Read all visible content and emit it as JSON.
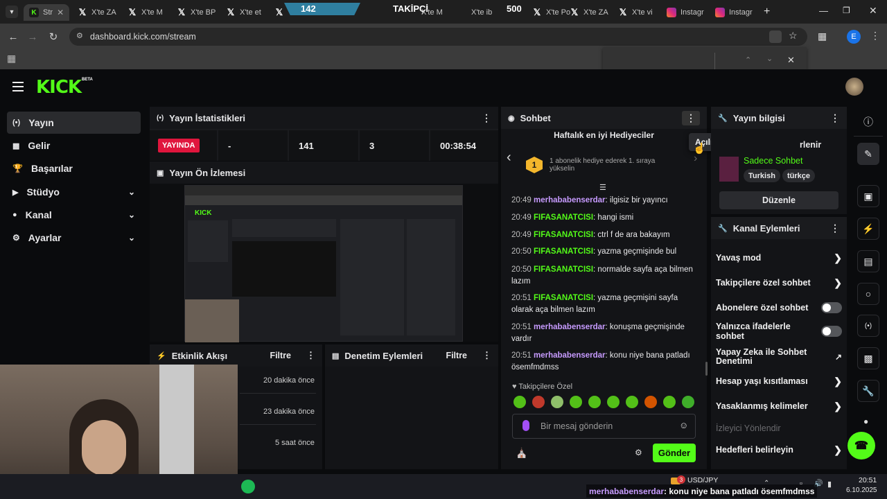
{
  "browser": {
    "tabs": [
      {
        "label": "Str",
        "icon": "kick-icon"
      },
      {
        "label": "X'te ZA",
        "icon": "x-icon"
      },
      {
        "label": "X'te M",
        "icon": "x-icon"
      },
      {
        "label": "X'te BP",
        "icon": "x-icon"
      },
      {
        "label": "X'te et",
        "icon": "x-icon"
      },
      {
        "label": "X'te M",
        "icon": "x-icon"
      },
      {
        "label": "X'te ib",
        "icon": "x-icon"
      },
      {
        "label": "X'te Po",
        "icon": "x-icon"
      },
      {
        "label": "X'te ZA",
        "icon": "x-icon"
      },
      {
        "label": "X'te vi",
        "icon": "x-icon"
      },
      {
        "label": "Instagr",
        "icon": "instagram-icon"
      },
      {
        "label": "Instagr",
        "icon": "instagram-icon"
      }
    ],
    "overlay_left": "142",
    "overlay_mid": "TAKİPÇİ",
    "overlay_right": "500",
    "url": "dashboard.kick.com/stream",
    "profile_initial": "E"
  },
  "kick": {
    "logo": "KICK",
    "beta": "BETA"
  },
  "sidebar": {
    "items": [
      {
        "label": "Yayın",
        "icon": "broadcast-icon",
        "active": true
      },
      {
        "label": "Gelir",
        "icon": "revenue-icon"
      },
      {
        "label": "Başarılar",
        "icon": "trophy-icon"
      },
      {
        "label": "Stüdyo",
        "icon": "studio-icon",
        "chevron": true
      },
      {
        "label": "Kanal",
        "icon": "channel-icon",
        "chevron": true
      },
      {
        "label": "Ayarlar",
        "icon": "settings-icon",
        "chevron": true
      }
    ]
  },
  "stats": {
    "title": "Yayın İstatistikleri",
    "live_badge": "YAYINDA",
    "values": [
      "-",
      "141",
      "3",
      "00:38:54"
    ]
  },
  "preview": {
    "title": "Yayın Ön İzlemesi"
  },
  "activity": {
    "title": "Etkinlik Akışı",
    "filter": "Filtre",
    "times": [
      "20 dakika önce",
      "23 dakika önce",
      "5 saat önce"
    ]
  },
  "moderation": {
    "title": "Denetim Eylemleri",
    "filter": "Filtre"
  },
  "chat": {
    "title": "Sohbet",
    "tooltip": "Açılır Pencerede Sohbet",
    "gifters_title": "Haftalık en iyi Hediyeciler",
    "gifters_text": "1 abonelik hediye ederek 1. sıraya yükselin",
    "rank": "1",
    "messages": [
      {
        "time": "20:49",
        "user": "merhababenserdar",
        "text": "ilgisiz bir yayıncı",
        "color": "u1"
      },
      {
        "time": "20:49",
        "user": "FIFASANATCISI",
        "text": "hangi ismi",
        "color": "u2"
      },
      {
        "time": "20:49",
        "user": "FIFASANATCISI",
        "text": "ctrl f de ara bakayım",
        "color": "u2"
      },
      {
        "time": "20:50",
        "user": "FIFASANATCISI",
        "text": "yazma geçmişinde bul",
        "color": "u2"
      },
      {
        "time": "20:50",
        "user": "FIFASANATCISI",
        "text": "normalde sayfa aça bilmen lazım",
        "color": "u2"
      },
      {
        "time": "20:51",
        "user": "FIFASANATCISI",
        "text": "yazma geçmişini sayfa olarak aça bilmen lazım",
        "color": "u2"
      },
      {
        "time": "20:51",
        "user": "merhababenserdar",
        "text": "konuşma geçmişinde vardır",
        "color": "u1"
      },
      {
        "time": "20:51",
        "user": "merhababenserdar",
        "text": "konu niye bana patladı ösemfmdmss",
        "color": "u1"
      }
    ],
    "followers_only": "Takipçilere Özel",
    "input_placeholder": "Bir mesaj gönderin",
    "send": "Gönder"
  },
  "stream_info": {
    "title": "Yayın bilgisi",
    "partial_text": "rlenir",
    "category": "Sadece Sohbet",
    "tags": [
      "Turkish",
      "türkçe"
    ],
    "edit": "Düzenle"
  },
  "channel_actions": {
    "title": "Kanal Eylemleri",
    "rows": [
      {
        "label": "Yavaş mod",
        "type": "arrow"
      },
      {
        "label": "Takipçilere özel sohbet",
        "type": "arrow"
      },
      {
        "label": "Abonelere özel sohbet",
        "type": "toggle"
      },
      {
        "label": "Yalnızca ifadelerle sohbet",
        "type": "toggle"
      },
      {
        "label": "Yapay Zeka ile Sohbet Denetimi",
        "type": "external"
      },
      {
        "label": "Hesap yaşı kısıtlaması",
        "type": "arrow"
      },
      {
        "label": "Yasaklanmış kelimeler",
        "type": "arrow"
      },
      {
        "label": "İzleyici Yönlendir",
        "type": "disabled"
      },
      {
        "label": "Hedefleri belirleyin",
        "type": "arrow"
      }
    ]
  },
  "taskbar": {
    "notif_count": "3",
    "currency": "USD/JPY",
    "time": "20:51",
    "date": "6.10.2025",
    "ticker_user": "merhababenserdar",
    "ticker_text": " : konu niye bana patladı ösemfmdmss"
  },
  "colors": {
    "accent": "#53fc18",
    "live": "#e0163d",
    "panel": "#1a1b1e",
    "bg": "#0a0b0d"
  }
}
